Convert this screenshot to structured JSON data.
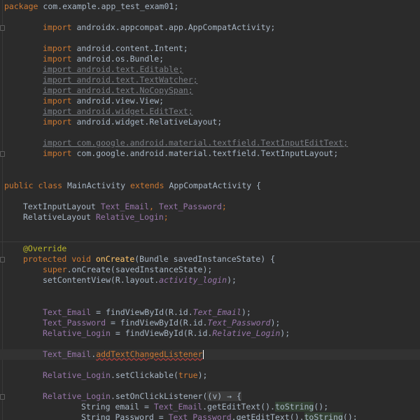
{
  "editor": {
    "lines": {
      "package_kw": "package",
      "package_name": " com.example.app_test_exam01;",
      "import_kw": "import",
      "imp_appcompat": " androidx.appcompat.app.AppCompatActivity;",
      "imp_intent": " android.content.Intent;",
      "imp_bundle": " android.os.Bundle;",
      "imp_editable": "import android.text.Editable;",
      "imp_textwatcher": "import android.text.TextWatcher;",
      "imp_nocopyspan": "import android.text.NoCopySpan;",
      "imp_view": " android.view.View;",
      "imp_edittext": "import android.widget.EditText;",
      "imp_relativelayout": " android.widget.RelativeLayout;",
      "imp_textinputedittext": "import com.google.android.material.textfield.TextInputEditText;",
      "imp_textinputlayout": " com.google.android.material.textfield.TextInputLayout;",
      "class_public": "public",
      "class_class": " class ",
      "class_name": "MainActivity",
      "class_extends": " extends ",
      "class_parent": "AppCompatActivity {",
      "decl1_type": "TextInputLayout ",
      "decl1_f1": "Text_Email",
      "decl1_sep": ", ",
      "decl1_f2": "Text_Password",
      "decl1_end": ";",
      "decl2_type": "RelativeLayout ",
      "decl2_f1": "Relative_Login",
      "decl2_end": ";",
      "override": "@Override",
      "m_protected": "protected",
      "m_void": " void ",
      "m_name": "onCreate",
      "m_params": "(Bundle savedInstanceState) {",
      "super_kw": "super",
      "super_rest": ".onCreate(savedInstanceState);",
      "setcv_a": "setContentView(R.layout.",
      "setcv_b": "activity_login",
      "setcv_c": ");",
      "fv1_a": "Text_Email",
      "fv1_b": " = findViewById(R.id.",
      "fv1_c": "Text_Email",
      "fv1_d": ");",
      "fv2_a": "Text_Password",
      "fv2_b": " = findViewById(R.id.",
      "fv2_c": "Text_Password",
      "fv2_d": ");",
      "fv3_a": "Relative_Login",
      "fv3_b": " = findViewById(R.id.",
      "fv3_c": "Relative_Login",
      "fv3_d": ");",
      "tcl_a": "Text_Email",
      "tcl_b": ".",
      "tcl_c": "addTextChangedListener",
      "sc_a": "Relative_Login",
      "sc_b": ".setClickable(",
      "sc_c": "true",
      "sc_d": ");",
      "ocl_a": "Relative_Login",
      "ocl_b": ".setOnClickListener(",
      "ocl_c": "(v) → {",
      "str1_a": "String email = ",
      "str1_b": "Text_Email",
      "str1_c": ".getEditText().",
      "str1_d": "toString",
      "str1_e": "();",
      "str2_a": "String Password = ",
      "str2_b": "Text_Password",
      "str2_c": ".getEditText().",
      "str2_d": "toString",
      "str2_e": "();"
    }
  }
}
